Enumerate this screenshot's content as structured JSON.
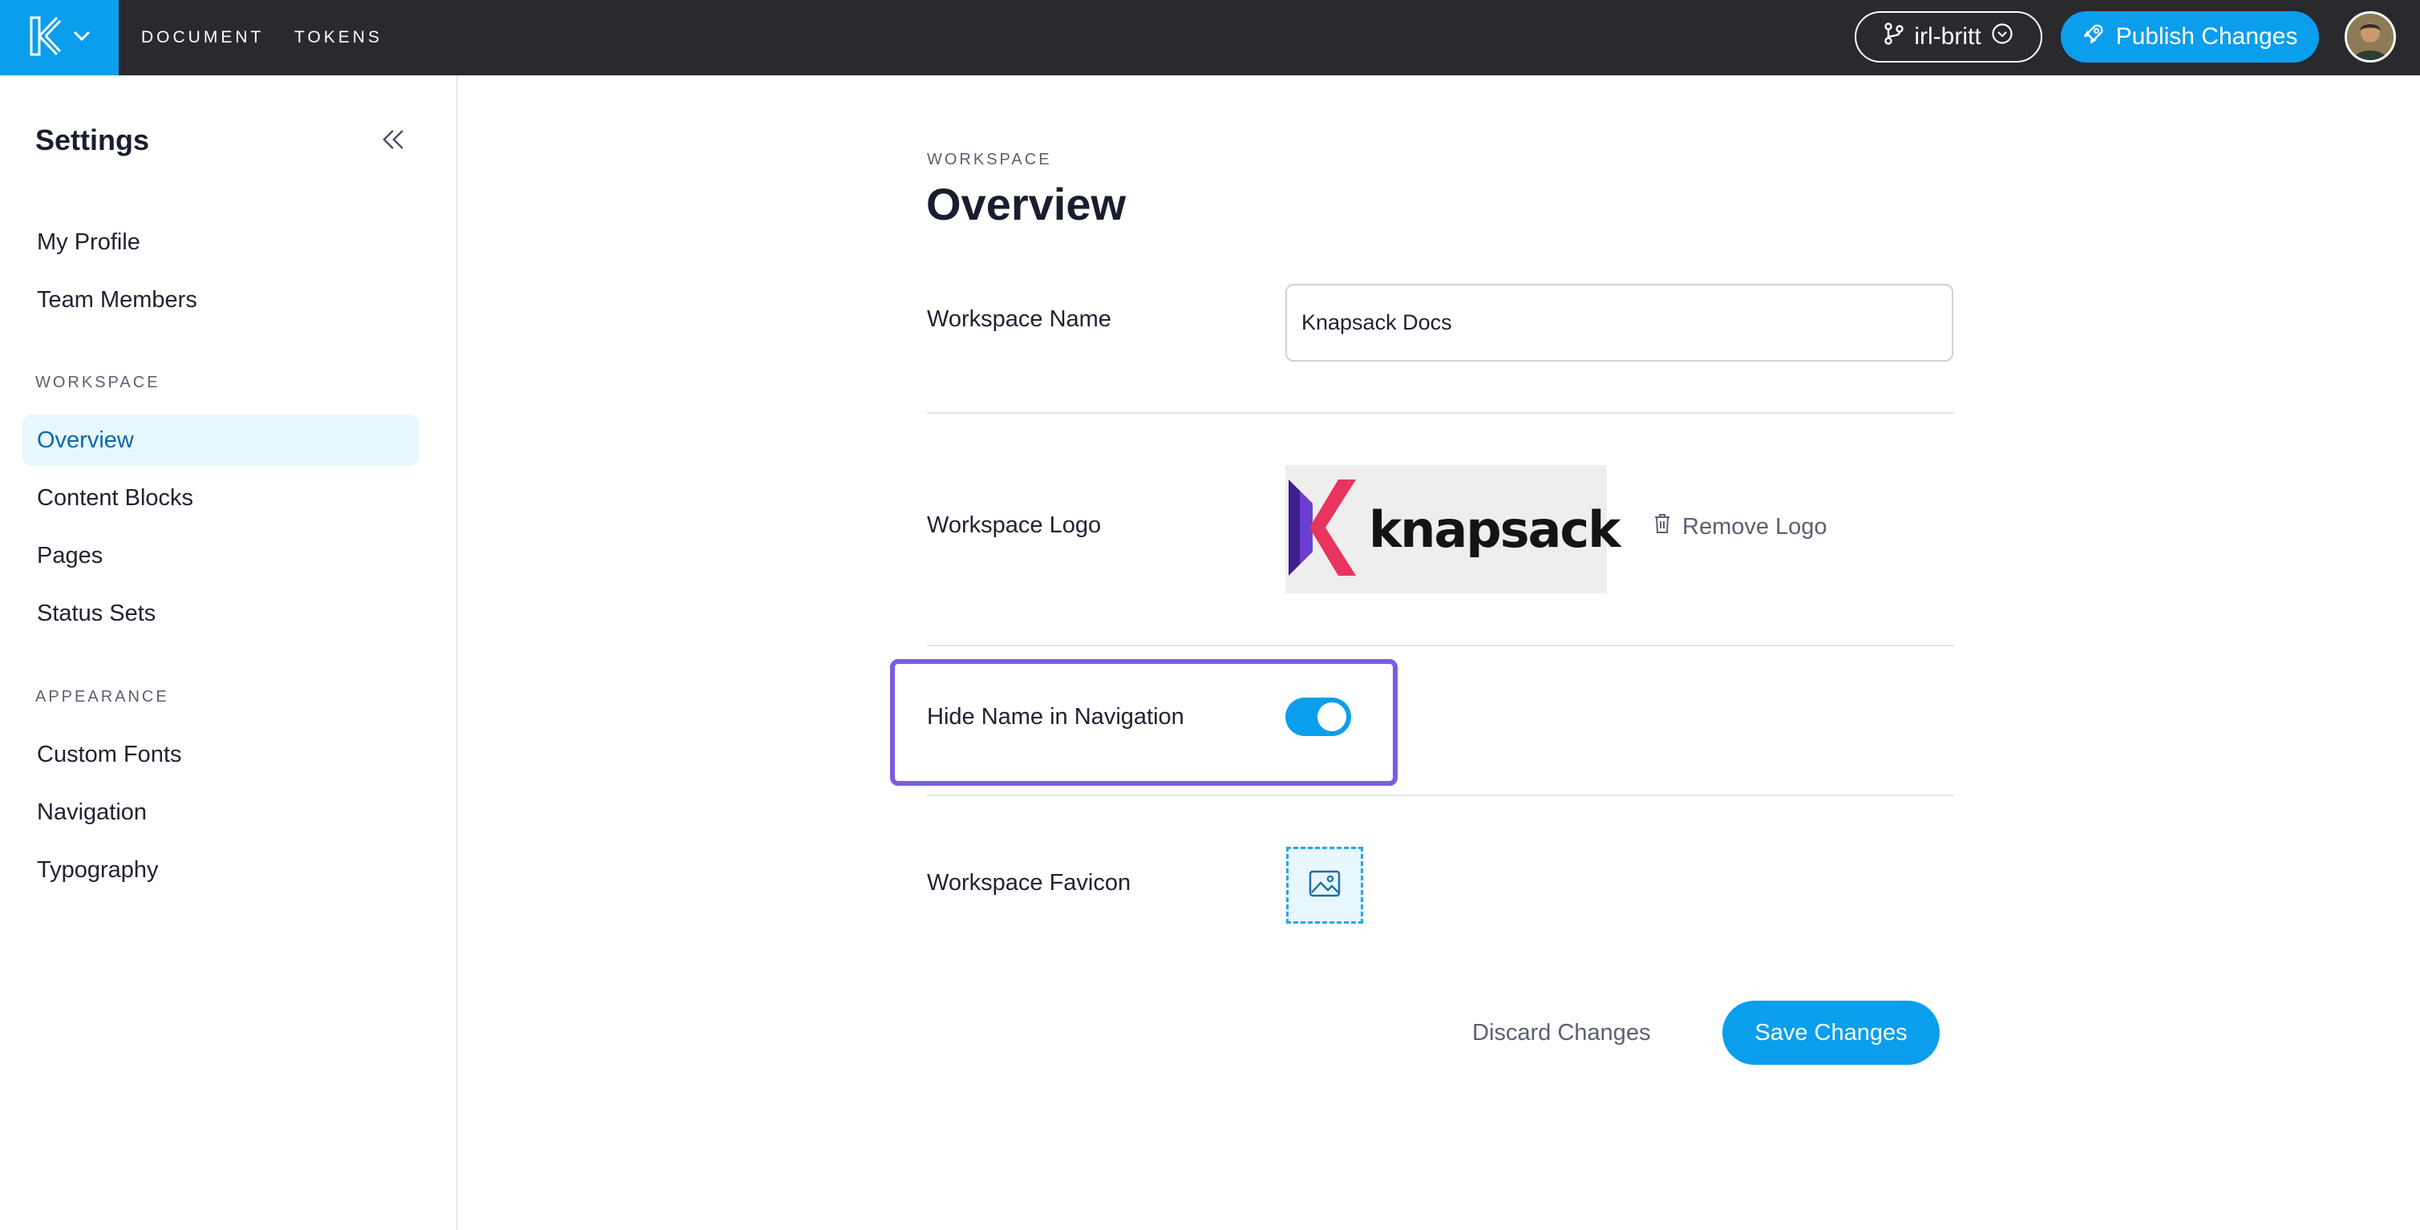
{
  "topbar": {
    "tabs": [
      {
        "label": "DOCUMENT"
      },
      {
        "label": "TOKENS"
      }
    ],
    "branch_label": "irl-britt",
    "publish_label": "Publish Changes",
    "logo_icon": "knapsack-k-icon",
    "colors": {
      "bar": "#2a292e",
      "accent": "#0b9eed"
    }
  },
  "sidebar": {
    "title": "Settings",
    "items_top": [
      {
        "label": "My Profile"
      },
      {
        "label": "Team Members"
      }
    ],
    "workspace_section": "WORKSPACE",
    "workspace_items": [
      {
        "label": "Overview",
        "active": true
      },
      {
        "label": "Content Blocks"
      },
      {
        "label": "Pages"
      },
      {
        "label": "Status Sets"
      }
    ],
    "appearance_section": "APPEARANCE",
    "appearance_items": [
      {
        "label": "Custom Fonts"
      },
      {
        "label": "Navigation"
      },
      {
        "label": "Typography"
      }
    ]
  },
  "main": {
    "eyebrow": "WORKSPACE",
    "title": "Overview",
    "workspace_name": {
      "label": "Workspace Name",
      "value": "Knapsack Docs"
    },
    "workspace_logo": {
      "label": "Workspace Logo",
      "logo_text": "knapsack",
      "remove_label": "Remove Logo"
    },
    "hide_name": {
      "label": "Hide Name in Navigation",
      "enabled": true
    },
    "favicon": {
      "label": "Workspace Favicon",
      "icon": "image-icon"
    },
    "discard_label": "Discard Changes",
    "save_label": "Save Changes",
    "colors": {
      "highlight": "#7b5ce6",
      "accent": "#0b9eed"
    }
  }
}
